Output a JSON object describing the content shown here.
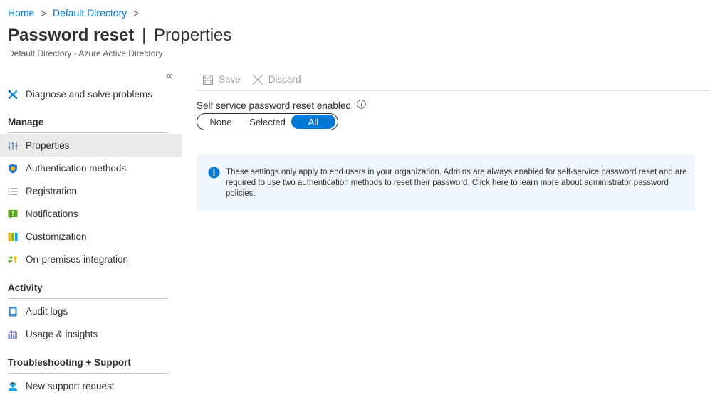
{
  "breadcrumb": {
    "home": "Home",
    "directory": "Default Directory",
    "separator": ">"
  },
  "page": {
    "title_main": "Password reset",
    "title_divider": "|",
    "title_section": "Properties",
    "subtitle": "Default Directory - Azure Active Directory"
  },
  "sidebar": {
    "collapse_glyph": "«",
    "diagnose": "Diagnose and solve problems",
    "manage_header": "Manage",
    "manage_items": [
      {
        "label": "Properties",
        "icon": "properties-sliders-icon",
        "active": true
      },
      {
        "label": "Authentication methods",
        "icon": "shield-icon"
      },
      {
        "label": "Registration",
        "icon": "list-icon"
      },
      {
        "label": "Notifications",
        "icon": "notification-icon"
      },
      {
        "label": "Customization",
        "icon": "customization-icon"
      },
      {
        "label": "On-premises integration",
        "icon": "sync-key-icon"
      }
    ],
    "activity_header": "Activity",
    "activity_items": [
      {
        "label": "Audit logs",
        "icon": "audit-log-icon"
      },
      {
        "label": "Usage & insights",
        "icon": "bar-chart-icon"
      }
    ],
    "support_header": "Troubleshooting + Support",
    "support_items": [
      {
        "label": "New support request",
        "icon": "support-person-icon"
      }
    ]
  },
  "toolbar": {
    "save_label": "Save",
    "discard_label": "Discard"
  },
  "sspr": {
    "label": "Self service password reset enabled",
    "options": [
      "None",
      "Selected",
      "All"
    ],
    "selected": "All"
  },
  "info": {
    "text": "These settings only apply to end users in your organization. Admins are always enabled for self-service password reset and are required to use two authentication methods to reset their password. Click here to learn more about administrator password policies."
  },
  "colors": {
    "accent": "#0078d4",
    "info_bg": "#eff6fc",
    "active_nav_bg": "#edebe9",
    "disabled_text": "#a19f9d"
  }
}
